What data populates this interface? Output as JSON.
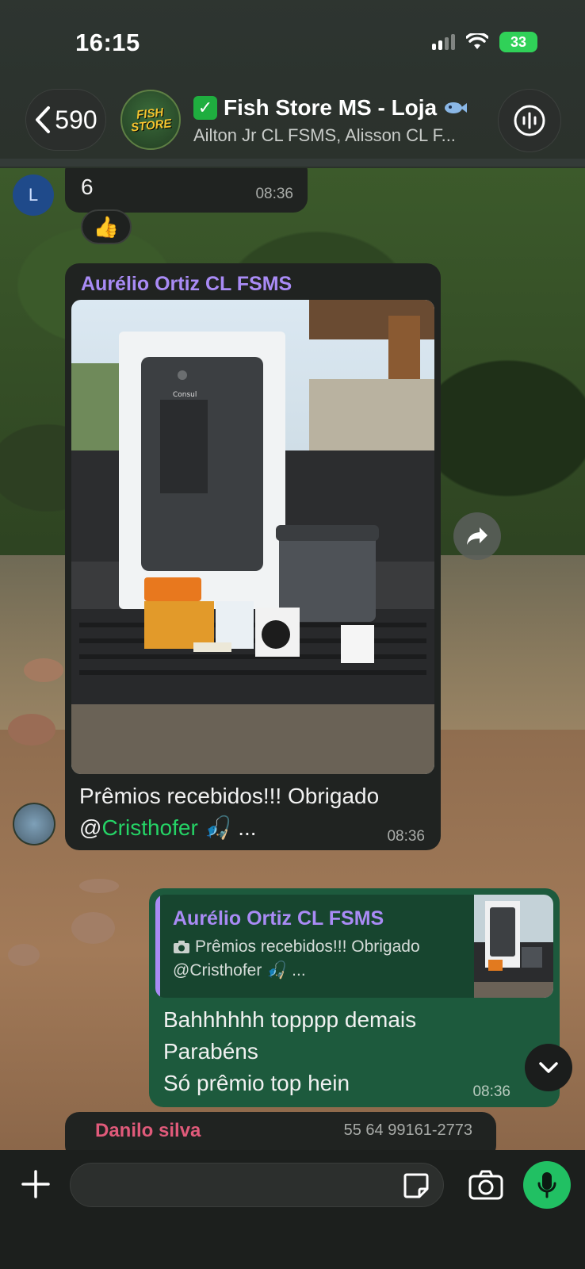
{
  "status_bar": {
    "time": "16:15",
    "battery": "33"
  },
  "header": {
    "back_count": "590",
    "avatar_logo": "FISH STORE",
    "title": "Fish Store MS - Loja",
    "subtitle": "Ailton Jr CL FSMS, Alisson CL F..."
  },
  "messages": {
    "partial_top": {
      "avatar_letter": "L",
      "text": "6",
      "time": "08:36",
      "reaction": "👍"
    },
    "photo_message": {
      "sender": "Aurélio Ortiz CL FSMS",
      "caption_line1": "Prêmios recebidos!!! Obrigado",
      "mention_at": "@",
      "mention": "Cristhofer",
      "caption_tail": "🎣 ...",
      "time": "08:36",
      "photo_text": "Consul"
    },
    "reply_message": {
      "quoted_sender": "Aurélio Ortiz CL FSMS",
      "quoted_line1": "Prêmios recebidos!!! Obrigado",
      "quoted_line2": "@Cristhofer 🎣 ...",
      "line1": "Bahhhhhh topppp demais",
      "line2": "Parabéns",
      "line3": "Só prêmio top hein",
      "time": "08:36"
    },
    "partial_bottom": {
      "sender": "Danilo silva",
      "phone": "55 64 99161-2773"
    }
  },
  "composer": {
    "placeholder": ""
  },
  "icons": {
    "back": "chevron-left-icon",
    "call": "audio-wave-icon",
    "forward": "forward-icon",
    "scroll": "chevron-down-icon",
    "plus": "plus-icon",
    "sticker": "sticker-icon",
    "camera": "camera-icon",
    "mic": "microphone-icon"
  },
  "colors": {
    "accent_green": "#21c063",
    "sender_purple": "#a98bf5",
    "mention_green": "#25d366",
    "outgoing_bubble": "#1d5a3d",
    "incoming_bubble": "#202321"
  }
}
